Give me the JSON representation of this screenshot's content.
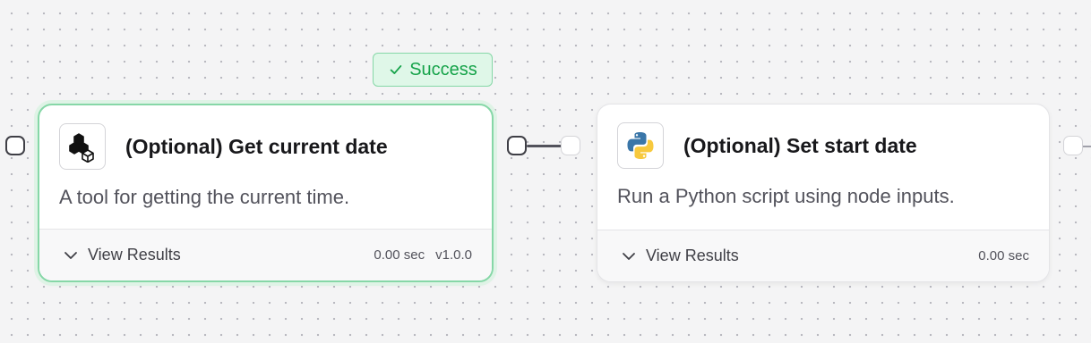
{
  "status_badge": {
    "label": "Success",
    "color": "#16a34a"
  },
  "nodes": [
    {
      "title": "(Optional) Get current date",
      "description": "A tool for getting the current time.",
      "icon": "cubes-icon",
      "footer": {
        "view_results_label": "View Results",
        "duration": "0.00 sec",
        "version": "v1.0.0"
      },
      "status": "success"
    },
    {
      "title": "(Optional) Set start date",
      "description": "Run a Python script using node inputs.",
      "icon": "python-icon",
      "footer": {
        "view_results_label": "View Results",
        "duration": "0.00 sec"
      }
    }
  ]
}
